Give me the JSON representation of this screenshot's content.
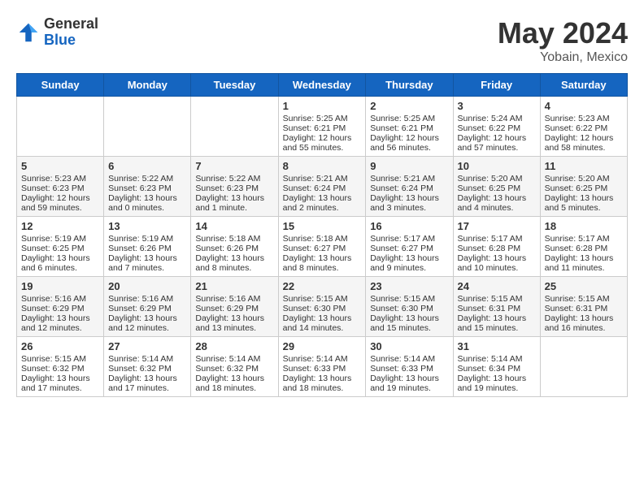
{
  "header": {
    "logo_general": "General",
    "logo_blue": "Blue",
    "month": "May 2024",
    "location": "Yobain, Mexico"
  },
  "days_of_week": [
    "Sunday",
    "Monday",
    "Tuesday",
    "Wednesday",
    "Thursday",
    "Friday",
    "Saturday"
  ],
  "weeks": [
    [
      {
        "day": "",
        "sunrise": "",
        "sunset": "",
        "daylight": "",
        "empty": true
      },
      {
        "day": "",
        "sunrise": "",
        "sunset": "",
        "daylight": "",
        "empty": true
      },
      {
        "day": "",
        "sunrise": "",
        "sunset": "",
        "daylight": "",
        "empty": true
      },
      {
        "day": "1",
        "sunrise": "Sunrise: 5:25 AM",
        "sunset": "Sunset: 6:21 PM",
        "daylight": "Daylight: 12 hours and 55 minutes."
      },
      {
        "day": "2",
        "sunrise": "Sunrise: 5:25 AM",
        "sunset": "Sunset: 6:21 PM",
        "daylight": "Daylight: 12 hours and 56 minutes."
      },
      {
        "day": "3",
        "sunrise": "Sunrise: 5:24 AM",
        "sunset": "Sunset: 6:22 PM",
        "daylight": "Daylight: 12 hours and 57 minutes."
      },
      {
        "day": "4",
        "sunrise": "Sunrise: 5:23 AM",
        "sunset": "Sunset: 6:22 PM",
        "daylight": "Daylight: 12 hours and 58 minutes."
      }
    ],
    [
      {
        "day": "5",
        "sunrise": "Sunrise: 5:23 AM",
        "sunset": "Sunset: 6:23 PM",
        "daylight": "Daylight: 12 hours and 59 minutes."
      },
      {
        "day": "6",
        "sunrise": "Sunrise: 5:22 AM",
        "sunset": "Sunset: 6:23 PM",
        "daylight": "Daylight: 13 hours and 0 minutes."
      },
      {
        "day": "7",
        "sunrise": "Sunrise: 5:22 AM",
        "sunset": "Sunset: 6:23 PM",
        "daylight": "Daylight: 13 hours and 1 minute."
      },
      {
        "day": "8",
        "sunrise": "Sunrise: 5:21 AM",
        "sunset": "Sunset: 6:24 PM",
        "daylight": "Daylight: 13 hours and 2 minutes."
      },
      {
        "day": "9",
        "sunrise": "Sunrise: 5:21 AM",
        "sunset": "Sunset: 6:24 PM",
        "daylight": "Daylight: 13 hours and 3 minutes."
      },
      {
        "day": "10",
        "sunrise": "Sunrise: 5:20 AM",
        "sunset": "Sunset: 6:25 PM",
        "daylight": "Daylight: 13 hours and 4 minutes."
      },
      {
        "day": "11",
        "sunrise": "Sunrise: 5:20 AM",
        "sunset": "Sunset: 6:25 PM",
        "daylight": "Daylight: 13 hours and 5 minutes."
      }
    ],
    [
      {
        "day": "12",
        "sunrise": "Sunrise: 5:19 AM",
        "sunset": "Sunset: 6:25 PM",
        "daylight": "Daylight: 13 hours and 6 minutes."
      },
      {
        "day": "13",
        "sunrise": "Sunrise: 5:19 AM",
        "sunset": "Sunset: 6:26 PM",
        "daylight": "Daylight: 13 hours and 7 minutes."
      },
      {
        "day": "14",
        "sunrise": "Sunrise: 5:18 AM",
        "sunset": "Sunset: 6:26 PM",
        "daylight": "Daylight: 13 hours and 8 minutes."
      },
      {
        "day": "15",
        "sunrise": "Sunrise: 5:18 AM",
        "sunset": "Sunset: 6:27 PM",
        "daylight": "Daylight: 13 hours and 8 minutes."
      },
      {
        "day": "16",
        "sunrise": "Sunrise: 5:17 AM",
        "sunset": "Sunset: 6:27 PM",
        "daylight": "Daylight: 13 hours and 9 minutes."
      },
      {
        "day": "17",
        "sunrise": "Sunrise: 5:17 AM",
        "sunset": "Sunset: 6:28 PM",
        "daylight": "Daylight: 13 hours and 10 minutes."
      },
      {
        "day": "18",
        "sunrise": "Sunrise: 5:17 AM",
        "sunset": "Sunset: 6:28 PM",
        "daylight": "Daylight: 13 hours and 11 minutes."
      }
    ],
    [
      {
        "day": "19",
        "sunrise": "Sunrise: 5:16 AM",
        "sunset": "Sunset: 6:29 PM",
        "daylight": "Daylight: 13 hours and 12 minutes."
      },
      {
        "day": "20",
        "sunrise": "Sunrise: 5:16 AM",
        "sunset": "Sunset: 6:29 PM",
        "daylight": "Daylight: 13 hours and 12 minutes."
      },
      {
        "day": "21",
        "sunrise": "Sunrise: 5:16 AM",
        "sunset": "Sunset: 6:29 PM",
        "daylight": "Daylight: 13 hours and 13 minutes."
      },
      {
        "day": "22",
        "sunrise": "Sunrise: 5:15 AM",
        "sunset": "Sunset: 6:30 PM",
        "daylight": "Daylight: 13 hours and 14 minutes."
      },
      {
        "day": "23",
        "sunrise": "Sunrise: 5:15 AM",
        "sunset": "Sunset: 6:30 PM",
        "daylight": "Daylight: 13 hours and 15 minutes."
      },
      {
        "day": "24",
        "sunrise": "Sunrise: 5:15 AM",
        "sunset": "Sunset: 6:31 PM",
        "daylight": "Daylight: 13 hours and 15 minutes."
      },
      {
        "day": "25",
        "sunrise": "Sunrise: 5:15 AM",
        "sunset": "Sunset: 6:31 PM",
        "daylight": "Daylight: 13 hours and 16 minutes."
      }
    ],
    [
      {
        "day": "26",
        "sunrise": "Sunrise: 5:15 AM",
        "sunset": "Sunset: 6:32 PM",
        "daylight": "Daylight: 13 hours and 17 minutes."
      },
      {
        "day": "27",
        "sunrise": "Sunrise: 5:14 AM",
        "sunset": "Sunset: 6:32 PM",
        "daylight": "Daylight: 13 hours and 17 minutes."
      },
      {
        "day": "28",
        "sunrise": "Sunrise: 5:14 AM",
        "sunset": "Sunset: 6:32 PM",
        "daylight": "Daylight: 13 hours and 18 minutes."
      },
      {
        "day": "29",
        "sunrise": "Sunrise: 5:14 AM",
        "sunset": "Sunset: 6:33 PM",
        "daylight": "Daylight: 13 hours and 18 minutes."
      },
      {
        "day": "30",
        "sunrise": "Sunrise: 5:14 AM",
        "sunset": "Sunset: 6:33 PM",
        "daylight": "Daylight: 13 hours and 19 minutes."
      },
      {
        "day": "31",
        "sunrise": "Sunrise: 5:14 AM",
        "sunset": "Sunset: 6:34 PM",
        "daylight": "Daylight: 13 hours and 19 minutes."
      },
      {
        "day": "",
        "sunrise": "",
        "sunset": "",
        "daylight": "",
        "empty": true
      }
    ]
  ]
}
